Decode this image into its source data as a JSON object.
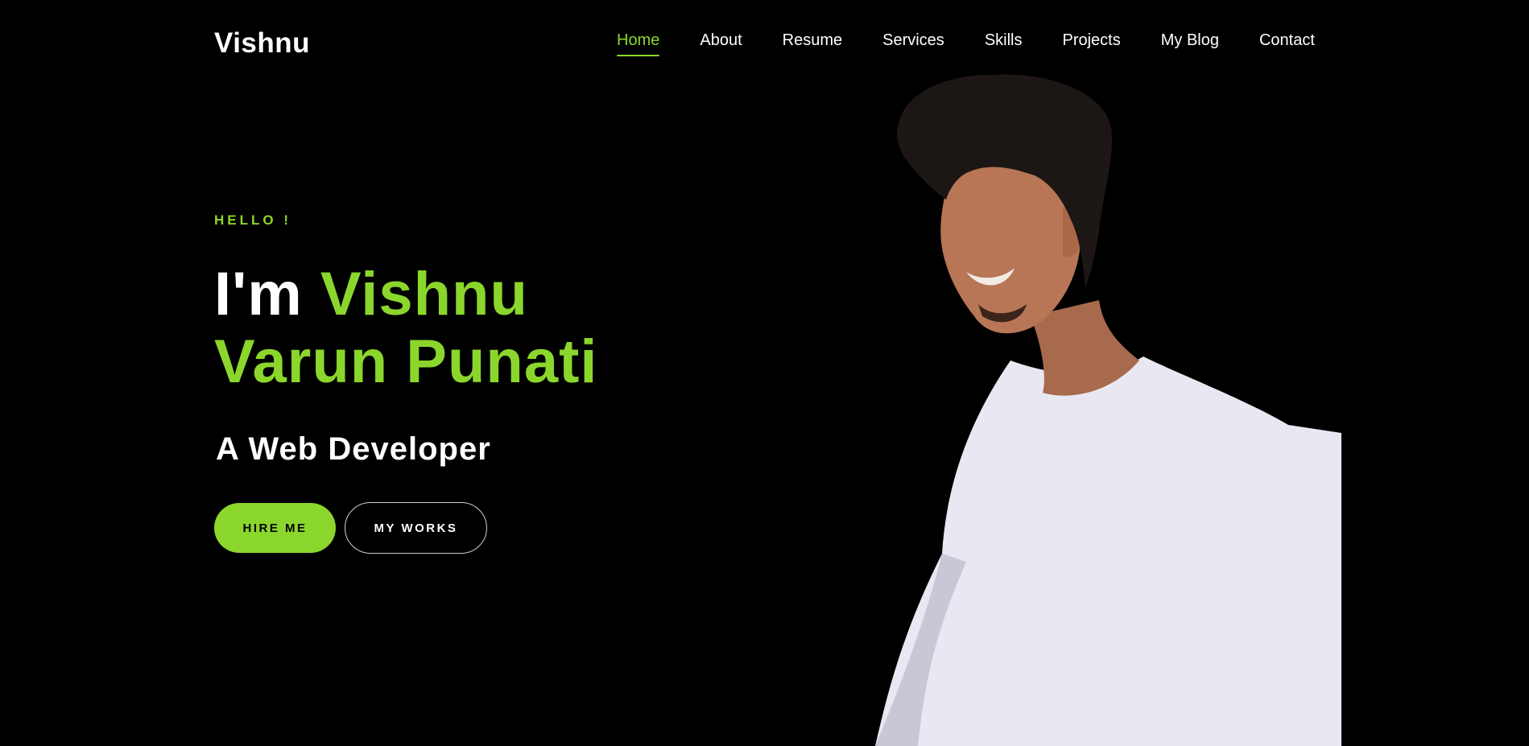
{
  "header": {
    "logo": "Vishnu"
  },
  "nav": {
    "items": [
      {
        "label": "Home",
        "active": true
      },
      {
        "label": "About",
        "active": false
      },
      {
        "label": "Resume",
        "active": false
      },
      {
        "label": "Services",
        "active": false
      },
      {
        "label": "Skills",
        "active": false
      },
      {
        "label": "Projects",
        "active": false
      },
      {
        "label": "My Blog",
        "active": false
      },
      {
        "label": "Contact",
        "active": false
      }
    ]
  },
  "hero": {
    "greeting": "HELLO !",
    "intro": "I'm",
    "name_line1": "Vishnu",
    "name_line2": "Varun Punati",
    "role": "A Web Developer",
    "primary_button": "HIRE ME",
    "secondary_button": "MY WORKS",
    "portrait_icon": "person-portrait-photo"
  },
  "colors": {
    "background": "#000000",
    "accent": "#8bd62c",
    "text": "#ffffff"
  }
}
